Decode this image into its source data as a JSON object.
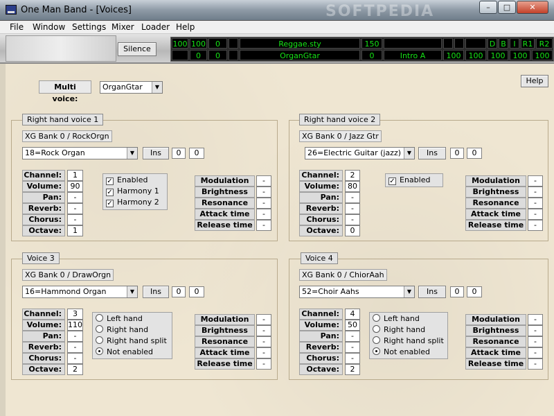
{
  "window": {
    "title": "One Man Band - [Voices]",
    "watermark": "SOFTPEDIA",
    "min": "–",
    "max": "□",
    "close": "✕"
  },
  "menu": [
    "File",
    "Window",
    "Settings",
    "Mixer",
    "Loader",
    "Help"
  ],
  "toolbar": {
    "silence": "Silence",
    "row1": [
      "100",
      "100",
      "0",
      "",
      "Reggae.sty",
      "150",
      "",
      "",
      "",
      "",
      "D",
      "B",
      "I",
      "R1",
      "R2"
    ],
    "row2": [
      "",
      "0",
      "0",
      "",
      "OrganGtar",
      "0",
      "Intro A",
      "100",
      "100",
      "100",
      "100",
      "100"
    ]
  },
  "multi_voice": {
    "label": "Multi voice:",
    "value": "OrganGtar"
  },
  "help": "Help",
  "labels": {
    "channel": "Channel:",
    "volume": "Volume:",
    "pan": "Pan:",
    "reverb": "Reverb:",
    "chorus": "Chorus:",
    "octave": "Octave:",
    "modulation": "Modulation",
    "brightness": "Brightness",
    "resonance": "Resonance",
    "attack": "Attack time",
    "release": "Release time",
    "ins": "Ins",
    "dash": "-",
    "enabled": "Enabled",
    "harmony1": "Harmony 1",
    "harmony2": "Harmony 2",
    "left_hand": "Left hand",
    "right_hand": "Right hand",
    "right_hand_split": "Right hand split",
    "not_enabled": "Not enabled"
  },
  "voices": [
    {
      "title": "Right hand voice 1",
      "bank": "XG Bank 0 / RockOrgn",
      "instrument": "18=Rock Organ",
      "v1": "0",
      "v2": "0",
      "channel": "1",
      "volume": "90",
      "pan": "-",
      "reverb": "-",
      "chorus": "-",
      "octave": "1"
    },
    {
      "title": "Right hand voice 2",
      "bank": "XG Bank 0 / Jazz Gtr",
      "instrument": "26=Electric Guitar (jazz)",
      "v1": "0",
      "v2": "0",
      "channel": "2",
      "volume": "80",
      "pan": "-",
      "reverb": "-",
      "chorus": "-",
      "octave": "0"
    },
    {
      "title": "Voice 3",
      "bank": "XG Bank 0 / DrawOrgn",
      "instrument": "16=Hammond Organ",
      "v1": "0",
      "v2": "0",
      "channel": "3",
      "volume": "110",
      "pan": "-",
      "reverb": "-",
      "chorus": "-",
      "octave": "2"
    },
    {
      "title": "Voice 4",
      "bank": "XG Bank 0 / ChiorAah",
      "instrument": "52=Choir Aahs",
      "v1": "0",
      "v2": "0",
      "channel": "4",
      "volume": "50",
      "pan": "-",
      "reverb": "-",
      "chorus": "-",
      "octave": "2"
    }
  ],
  "colors": {
    "lcd_text": "#16e316",
    "lcd_bg": "#000000",
    "panel": "#efe6d2"
  }
}
